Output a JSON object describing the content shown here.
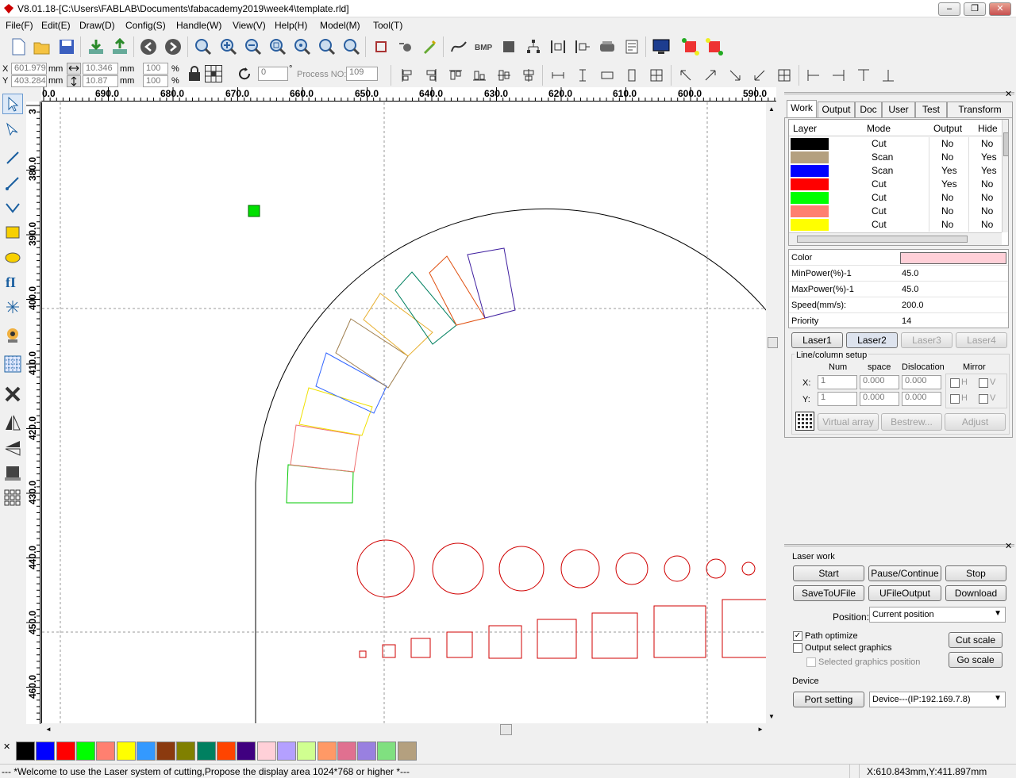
{
  "window": {
    "title": "V8.01.18-[C:\\Users\\FABLAB\\Documents\\fabacademy2019\\week4\\template.rld]",
    "min": "‒",
    "max": "❐",
    "close": "✕"
  },
  "menu": [
    "File(F)",
    "Edit(E)",
    "Draw(D)",
    "Config(S)",
    "Handle(W)",
    "View(V)",
    "Help(H)",
    "Model(M)",
    "Tool(T)"
  ],
  "coords": {
    "x_label": "X",
    "y_label": "Y",
    "x": "601.979",
    "y": "403.284",
    "mm": "mm",
    "w": "10.346",
    "h": "10.87",
    "sx": "100",
    "sy": "100",
    "pct": "%",
    "angle": "0",
    "deg": "°",
    "process_label": "Process NO:",
    "process_no": "109"
  },
  "hruler": [
    "0.0",
    "690.0",
    "680.0",
    "670.0",
    "660.0",
    "650.0",
    "640.0",
    "630.0",
    "620.0",
    "610.0",
    "600.0",
    "590.0"
  ],
  "vruler": [
    "3",
    "380.0",
    "390.0",
    "400.0",
    "410.0",
    "420.0",
    "430.0",
    "440.0",
    "450.0",
    "460.0"
  ],
  "tabs": [
    "Work",
    "Output",
    "Doc",
    "User",
    "Test",
    "Transform"
  ],
  "layer_headers": [
    "Layer",
    "Mode",
    "Output",
    "Hide"
  ],
  "layers": [
    {
      "color": "#000000",
      "mode": "Cut",
      "output": "No",
      "hide": "No"
    },
    {
      "color": "#b4a07f",
      "mode": "Scan",
      "output": "No",
      "hide": "Yes"
    },
    {
      "color": "#0000ff",
      "mode": "Scan",
      "output": "Yes",
      "hide": "Yes"
    },
    {
      "color": "#ff0000",
      "mode": "Cut",
      "output": "Yes",
      "hide": "No"
    },
    {
      "color": "#00ff00",
      "mode": "Cut",
      "output": "No",
      "hide": "No"
    },
    {
      "color": "#ff8070",
      "mode": "Cut",
      "output": "No",
      "hide": "No"
    },
    {
      "color": "#ffff00",
      "mode": "Cut",
      "output": "No",
      "hide": "No"
    }
  ],
  "props": [
    {
      "k": "Color",
      "v": ""
    },
    {
      "k": "MinPower(%)-1",
      "v": "45.0"
    },
    {
      "k": "MaxPower(%)-1",
      "v": "45.0"
    },
    {
      "k": "Speed(mm/s):",
      "v": "200.0"
    },
    {
      "k": "Priority",
      "v": "14"
    }
  ],
  "prop_color": "#ffd0d8",
  "lasers": [
    "Laser1",
    "Laser2",
    "Laser3",
    "Laser4"
  ],
  "linecol": {
    "title": "Line/column setup",
    "num": "Num",
    "space": "space",
    "dislocation": "Dislocation",
    "mirror": "Mirror",
    "x": "X:",
    "y": "Y:",
    "xnum": "1",
    "ynum": "1",
    "xspace": "0.000",
    "yspace": "0.000",
    "xdis": "0.000",
    "ydis": "0.000",
    "h": "H",
    "v": "V",
    "virtual": "Virtual array",
    "bestrew": "Bestrew...",
    "adjust": "Adjust"
  },
  "laserwork": {
    "title": "Laser work",
    "start": "Start",
    "pause": "Pause/Continue",
    "stop": "Stop",
    "save": "SaveToUFile",
    "ufile": "UFileOutput",
    "download": "Download",
    "position_label": "Position:",
    "position": "Current position",
    "path_opt": "Path optimize",
    "output_sel": "Output select graphics",
    "sel_pos": "Selected graphics position",
    "cut_scale": "Cut scale",
    "go_scale": "Go scale"
  },
  "device": {
    "title": "Device",
    "port": "Port setting",
    "device": "Device---(IP:192.169.7.8)"
  },
  "palette": [
    "#000000",
    "#0000ff",
    "#ff0000",
    "#00ff00",
    "#ff8070",
    "#ffff00",
    "#3399ff",
    "#8b3a0f",
    "#808000",
    "#008060",
    "#ff4400",
    "#400080",
    "#ffd0d8",
    "#b4a0ff",
    "#d0ff90",
    "#ff9966",
    "#e07090",
    "#9980e0",
    "#80e080",
    "#b4a07f"
  ],
  "status": {
    "message": "--- *Welcome to use the Laser system of cutting,Propose the display area 1024*768 or higher *---",
    "pos": "X:610.843mm,Y:411.897mm"
  }
}
